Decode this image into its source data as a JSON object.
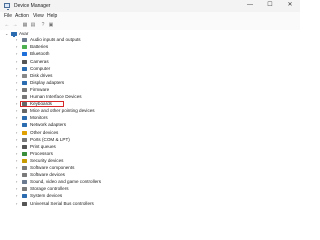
{
  "window": {
    "title": "Device Manager",
    "controls": {
      "minimize": "—",
      "maximize": "☐",
      "close": "✕"
    }
  },
  "menubar": {
    "items": [
      "File",
      "Action",
      "View",
      "Help"
    ]
  },
  "toolbar": {
    "buttons": [
      "back-icon",
      "forward-icon",
      "view-icon",
      "properties-icon",
      "help-icon",
      "show-hidden-icon"
    ],
    "glyphs": [
      "←",
      "→",
      "▦",
      "▤",
      "?",
      "▣"
    ]
  },
  "tree": {
    "root": {
      "label": "Avar",
      "expanded": true,
      "icon": "computer-icon"
    },
    "categories": [
      {
        "label": "Audio inputs and outputs",
        "icon": "audio-icon",
        "color": "#6b7a8f"
      },
      {
        "label": "Batteries",
        "icon": "battery-icon",
        "color": "#4caf50"
      },
      {
        "label": "Bluetooth",
        "icon": "bluetooth-icon",
        "color": "#1e6fd9"
      },
      {
        "label": "Cameras",
        "icon": "camera-icon",
        "color": "#555555"
      },
      {
        "label": "Computer",
        "icon": "computer-icon",
        "color": "#2b6cb0"
      },
      {
        "label": "Disk drives",
        "icon": "disk-icon",
        "color": "#888888"
      },
      {
        "label": "Display adapters",
        "icon": "display-icon",
        "color": "#2b6cb0"
      },
      {
        "label": "Firmware",
        "icon": "firmware-icon",
        "color": "#777777"
      },
      {
        "label": "Human Interface Devices",
        "icon": "hid-icon",
        "color": "#777777"
      },
      {
        "label": "Keyboards",
        "icon": "keyboard-icon",
        "color": "#666666",
        "highlighted": true
      },
      {
        "label": "Mice and other pointing devices",
        "icon": "mouse-icon",
        "color": "#666666"
      },
      {
        "label": "Monitors",
        "icon": "monitor-icon",
        "color": "#2b6cb0"
      },
      {
        "label": "Network adapters",
        "icon": "network-icon",
        "color": "#2b6cb0"
      },
      {
        "label": "Other devices",
        "icon": "other-device-icon",
        "color": "#e0a000"
      },
      {
        "label": "Ports (COM & LPT)",
        "icon": "port-icon",
        "color": "#777777"
      },
      {
        "label": "Print queues",
        "icon": "printer-icon",
        "color": "#555555"
      },
      {
        "label": "Processors",
        "icon": "processor-icon",
        "color": "#3a8d3a"
      },
      {
        "label": "Security devices",
        "icon": "security-icon",
        "color": "#c79a00"
      },
      {
        "label": "Software components",
        "icon": "software-component-icon",
        "color": "#7a7a7a"
      },
      {
        "label": "Software devices",
        "icon": "software-device-icon",
        "color": "#7a7a7a"
      },
      {
        "label": "Sound, video and game controllers",
        "icon": "sound-icon",
        "color": "#6b7a8f"
      },
      {
        "label": "Storage controllers",
        "icon": "storage-icon",
        "color": "#7a7a7a"
      },
      {
        "label": "System devices",
        "icon": "system-icon",
        "color": "#2b6cb0"
      },
      {
        "label": "Universal Serial Bus controllers",
        "icon": "usb-icon",
        "color": "#555555"
      }
    ]
  },
  "colors": {
    "highlight_border": "#d62828"
  }
}
